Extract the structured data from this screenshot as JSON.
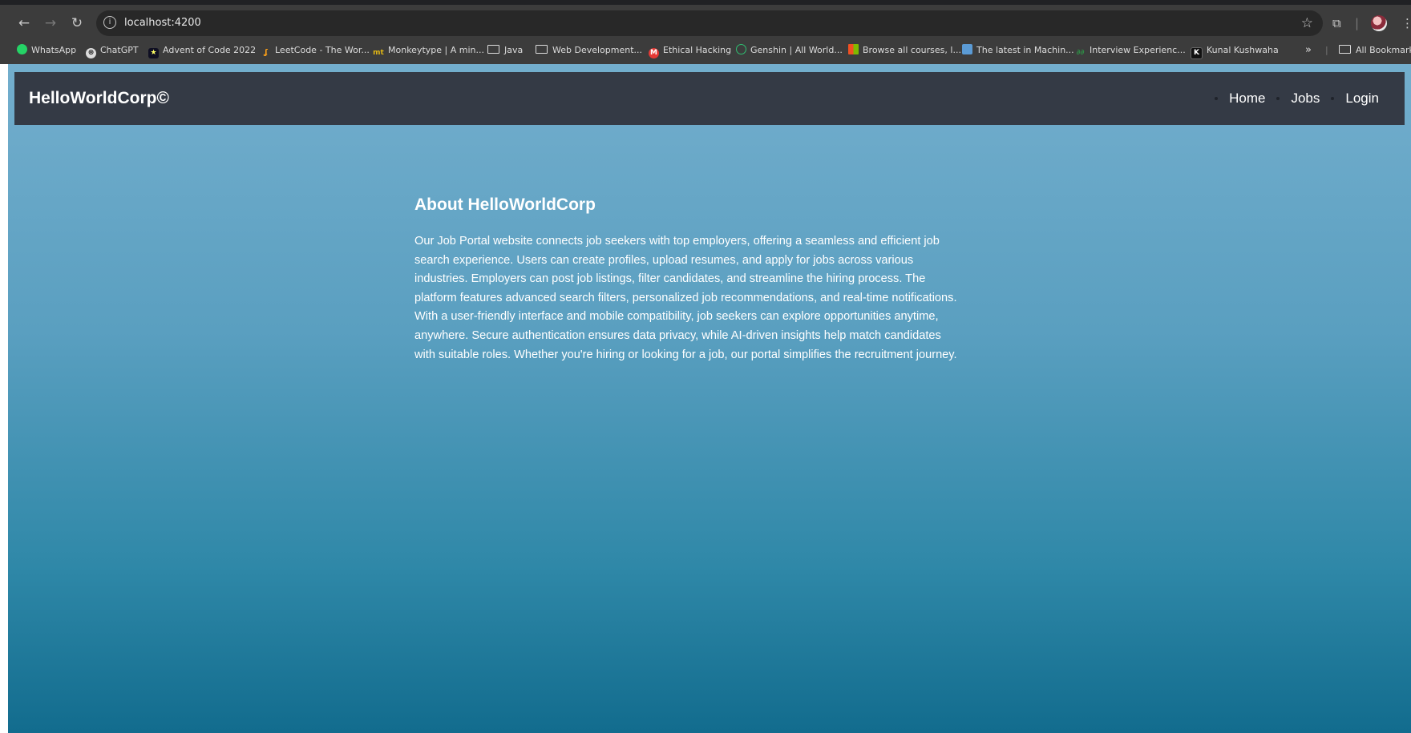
{
  "browser": {
    "url": "localhost:4200",
    "bookmarks": [
      {
        "label": "WhatsApp",
        "icon": "whatsapp-icon",
        "color": "#25d366"
      },
      {
        "label": "ChatGPT",
        "icon": "chatgpt-icon",
        "color": "#dcdcdc"
      },
      {
        "label": "Advent of Code 2022",
        "icon": "star-icon",
        "color": "#ffff66"
      },
      {
        "label": "LeetCode - The Wor...",
        "icon": "leetcode-icon",
        "color": "#ffa116"
      },
      {
        "label": "Monkeytype | A min...",
        "icon": "monkeytype-icon",
        "color": "#e2b714"
      },
      {
        "label": "Java",
        "icon": "folder-icon",
        "color": "#dcdcdc"
      },
      {
        "label": "Web Development...",
        "icon": "folder-icon",
        "color": "#dcdcdc"
      },
      {
        "label": "Ethical Hacking",
        "icon": "ethical-hacking-icon",
        "color": "#e53935"
      },
      {
        "label": "Genshin | All World...",
        "icon": "genshin-icon",
        "color": "#2fbf71"
      },
      {
        "label": "Browse all courses, l...",
        "icon": "microsoft-icon",
        "color": "#f25022"
      },
      {
        "label": "The latest in Machin...",
        "icon": "bookmark-page-icon",
        "color": "#5b9bd5"
      },
      {
        "label": "Interview Experienc...",
        "icon": "gfg-icon",
        "color": "#2f8d46"
      },
      {
        "label": "Kunal Kushwaha",
        "icon": "k-icon",
        "color": "#000000"
      }
    ],
    "overflow_label": "»",
    "all_bookmarks_label": "All Bookmarks"
  },
  "navbar": {
    "brand": "HelloWorldCorp©",
    "links": [
      "Home",
      "Jobs",
      "Login"
    ]
  },
  "about": {
    "title": "About HelloWorldCorp",
    "lines": [
      "Our Job Portal website connects job seekers with top employers, offering a seamless and efficient job",
      "search experience. Users can create profiles, upload resumes, and apply for jobs across various",
      "industries. Employers can post job listings, filter candidates, and streamline the hiring process. The",
      "platform features advanced search filters, personalized job recommendations, and real-time notifications.",
      "With a user-friendly interface and mobile compatibility, job seekers can explore opportunities anytime,",
      "anywhere. Secure authentication ensures data privacy, while AI-driven insights help match candidates",
      "with suitable roles. Whether you're hiring or looking for a job, our portal simplifies the recruitment journey."
    ]
  },
  "colors": {
    "navbar_bg": "#343a45",
    "page_gradient_top": "#73aecd",
    "page_gradient_bottom": "#126c8e",
    "text": "#ffffff"
  }
}
